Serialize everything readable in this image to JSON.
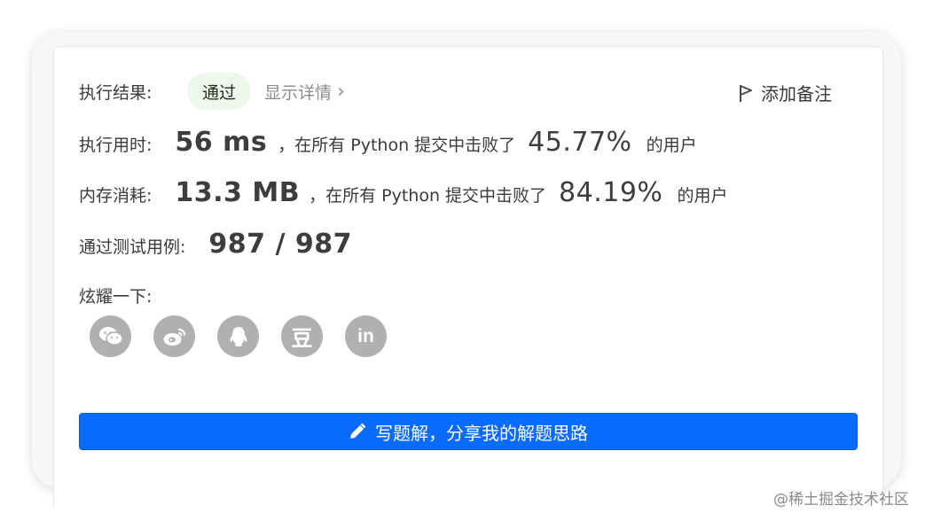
{
  "result": {
    "label": "执行结果:",
    "status": "通过",
    "details_link": "显示详情",
    "details_chevron": "›",
    "add_note": "添加备注"
  },
  "runtime": {
    "label": "执行用时:",
    "value": "56 ms",
    "prefix": "，在所有 Python 提交中击败了",
    "percent": "45.77%",
    "suffix": "的用户"
  },
  "memory": {
    "label": "内存消耗:",
    "value": "13.3 MB",
    "prefix": "，在所有 Python 提交中击败了",
    "percent": "84.19%",
    "suffix": "的用户"
  },
  "testcases": {
    "label": "通过测试用例:",
    "value": "987 / 987"
  },
  "share": {
    "label": "炫耀一下:",
    "icons": [
      "wechat-icon",
      "weibo-icon",
      "qq-icon",
      "douban-icon",
      "linkedin-icon"
    ],
    "douban_glyph": "豆",
    "linkedin_glyph": "in"
  },
  "solution_button": "写题解，分享我的解题思路",
  "watermark": "@稀土掘金技术社区",
  "colors": {
    "primary": "#0a6cff",
    "status_bg": "#eef8ea",
    "icon_gray": "#b0b0b0"
  }
}
